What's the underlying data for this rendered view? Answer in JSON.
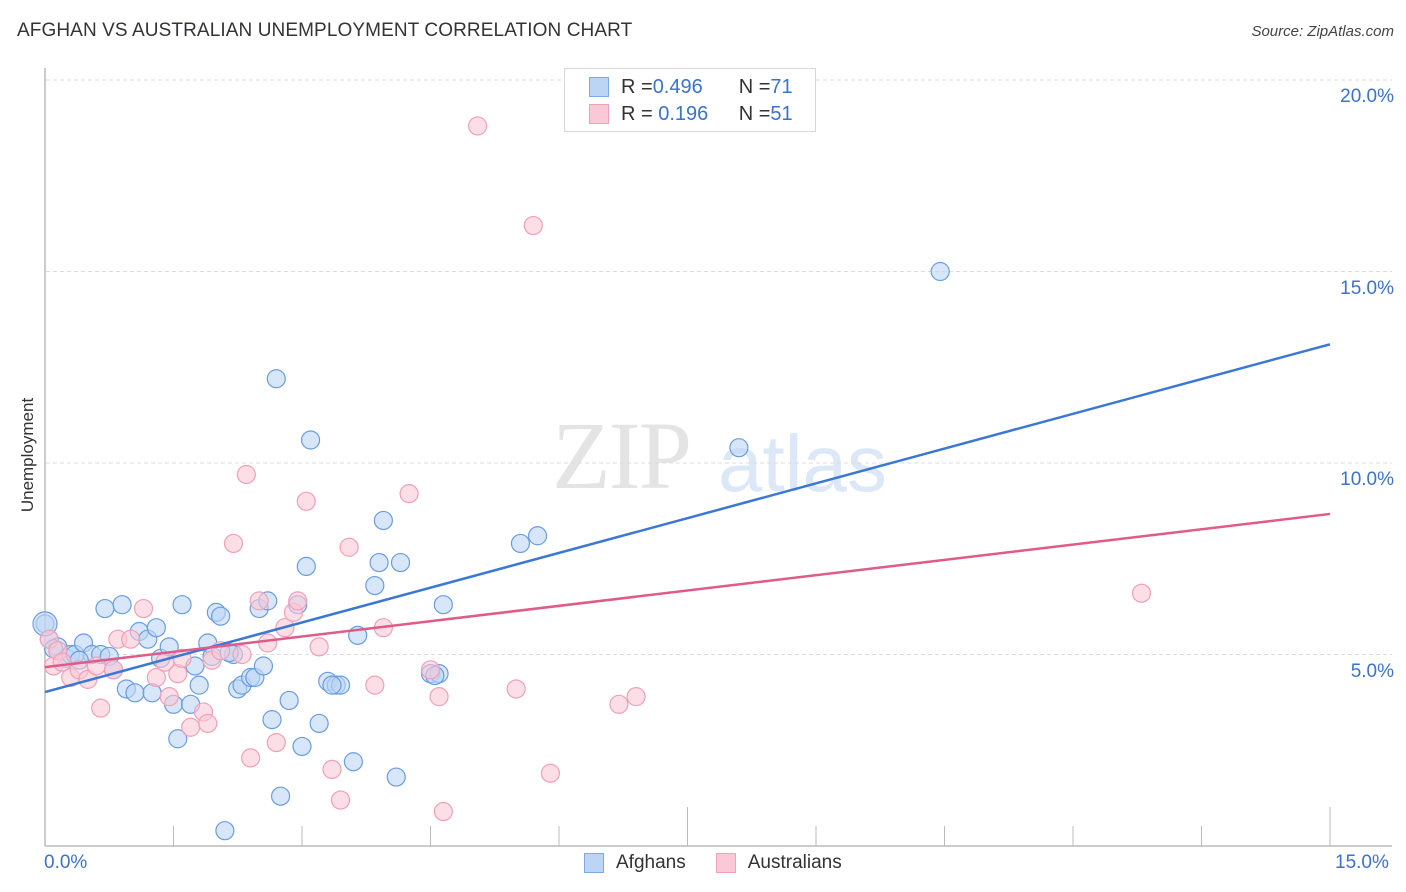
{
  "header": {
    "title": "AFGHAN VS AUSTRALIAN UNEMPLOYMENT CORRELATION CHART",
    "source": "Source: ZipAtlas.com"
  },
  "watermark": {
    "zip": "ZIP",
    "atlas": "atlas"
  },
  "legend": {
    "rows": [
      {
        "r_label": "R = ",
        "r_value": "0.496",
        "n_label": "N = ",
        "n_value": "71",
        "color": "#7aaae8",
        "fill": "#bcd5f5"
      },
      {
        "r_label": "R = ",
        "r_value": " 0.196",
        "n_label": "N = ",
        "n_value": "51",
        "color": "#f0a0b8",
        "fill": "#fac8d6"
      }
    ]
  },
  "chart_data": {
    "type": "scatter",
    "title": "AFGHAN VS AUSTRALIAN UNEMPLOYMENT CORRELATION CHART",
    "xlabel": "",
    "ylabel": "Unemployment",
    "xlim": [
      0,
      15
    ],
    "ylim": [
      0,
      20.5
    ],
    "x_tick_labels": [
      "0.0%",
      "15.0%"
    ],
    "y_ticks": [
      5,
      10,
      15,
      20
    ],
    "y_tick_labels": [
      "5.0%",
      "10.0%",
      "15.0%",
      "20.0%"
    ],
    "grid": "horizontal-dashed",
    "legend_position": "bottom-center",
    "series": [
      {
        "name": "Afghans",
        "color": "#3a78d4",
        "fill": "#bcd5f5",
        "stroke": "#6a9de0",
        "R": 0.496,
        "N": 71,
        "trend": {
          "x": [
            0,
            15
          ],
          "y": [
            4.02,
            13.1
          ]
        },
        "points": [
          [
            0.0,
            5.8
          ],
          [
            0.05,
            5.4
          ],
          [
            0.15,
            5.2
          ],
          [
            0.25,
            4.9
          ],
          [
            0.3,
            5.0
          ],
          [
            0.35,
            5.0
          ],
          [
            0.45,
            5.3
          ],
          [
            0.55,
            5.0
          ],
          [
            0.65,
            5.0
          ],
          [
            0.75,
            4.95
          ],
          [
            0.7,
            6.2
          ],
          [
            0.9,
            6.3
          ],
          [
            0.8,
            4.6
          ],
          [
            0.95,
            4.1
          ],
          [
            1.05,
            4.0
          ],
          [
            1.1,
            5.6
          ],
          [
            1.2,
            5.4
          ],
          [
            1.3,
            5.7
          ],
          [
            1.35,
            4.9
          ],
          [
            1.45,
            5.2
          ],
          [
            1.5,
            3.7
          ],
          [
            1.55,
            2.8
          ],
          [
            1.6,
            6.3
          ],
          [
            1.7,
            3.7
          ],
          [
            1.75,
            4.7
          ],
          [
            1.8,
            4.2
          ],
          [
            1.9,
            5.3
          ],
          [
            1.95,
            4.95
          ],
          [
            2.0,
            6.1
          ],
          [
            2.05,
            6.0
          ],
          [
            2.1,
            0.4
          ],
          [
            2.2,
            5.0
          ],
          [
            2.25,
            4.1
          ],
          [
            2.3,
            4.2
          ],
          [
            2.4,
            4.4
          ],
          [
            2.45,
            4.4
          ],
          [
            2.5,
            6.2
          ],
          [
            2.55,
            4.7
          ],
          [
            2.6,
            6.4
          ],
          [
            2.65,
            3.3
          ],
          [
            2.7,
            12.2
          ],
          [
            2.75,
            1.3
          ],
          [
            2.85,
            3.8
          ],
          [
            2.95,
            6.3
          ],
          [
            3.0,
            2.6
          ],
          [
            3.05,
            7.3
          ],
          [
            3.1,
            10.6
          ],
          [
            3.2,
            3.2
          ],
          [
            3.3,
            4.3
          ],
          [
            3.4,
            4.2
          ],
          [
            3.45,
            4.2
          ],
          [
            3.6,
            2.2
          ],
          [
            3.65,
            5.5
          ],
          [
            3.85,
            6.8
          ],
          [
            3.9,
            7.4
          ],
          [
            3.95,
            8.5
          ],
          [
            4.1,
            1.8
          ],
          [
            4.15,
            7.4
          ],
          [
            4.5,
            4.5
          ],
          [
            4.6,
            4.5
          ],
          [
            4.65,
            6.3
          ],
          [
            5.55,
            7.9
          ],
          [
            5.75,
            8.1
          ],
          [
            8.1,
            10.4
          ],
          [
            10.45,
            15.0
          ],
          [
            0.1,
            5.15
          ],
          [
            0.4,
            4.85
          ],
          [
            1.25,
            4.0
          ],
          [
            2.15,
            5.05
          ],
          [
            3.35,
            4.2
          ],
          [
            4.55,
            4.45
          ]
        ]
      },
      {
        "name": "Australians",
        "color": "#e05a8a",
        "fill": "#fac8d6",
        "stroke": "#f0a0b8",
        "R": 0.196,
        "N": 51,
        "trend": {
          "x": [
            0,
            15
          ],
          "y": [
            4.67,
            8.67
          ]
        },
        "points": [
          [
            0.05,
            5.4
          ],
          [
            0.1,
            4.7
          ],
          [
            0.15,
            5.1
          ],
          [
            0.2,
            4.8
          ],
          [
            0.3,
            4.4
          ],
          [
            0.4,
            4.6
          ],
          [
            0.5,
            4.35
          ],
          [
            0.6,
            4.7
          ],
          [
            0.65,
            3.6
          ],
          [
            0.8,
            4.6
          ],
          [
            0.85,
            5.4
          ],
          [
            1.0,
            5.4
          ],
          [
            1.15,
            6.2
          ],
          [
            1.3,
            4.4
          ],
          [
            1.4,
            4.8
          ],
          [
            1.45,
            3.9
          ],
          [
            1.55,
            4.5
          ],
          [
            1.6,
            4.9
          ],
          [
            1.7,
            3.1
          ],
          [
            1.85,
            3.5
          ],
          [
            1.9,
            3.2
          ],
          [
            1.95,
            4.85
          ],
          [
            2.05,
            5.1
          ],
          [
            2.2,
            7.9
          ],
          [
            2.3,
            5.0
          ],
          [
            2.35,
            9.7
          ],
          [
            2.4,
            2.3
          ],
          [
            2.5,
            6.4
          ],
          [
            2.6,
            5.3
          ],
          [
            2.7,
            2.7
          ],
          [
            2.8,
            5.7
          ],
          [
            2.9,
            6.1
          ],
          [
            2.95,
            6.4
          ],
          [
            3.05,
            9.0
          ],
          [
            3.2,
            5.2
          ],
          [
            3.35,
            2.0
          ],
          [
            3.45,
            1.2
          ],
          [
            3.55,
            7.8
          ],
          [
            3.85,
            4.2
          ],
          [
            3.95,
            5.7
          ],
          [
            4.25,
            9.2
          ],
          [
            4.5,
            4.6
          ],
          [
            4.6,
            3.9
          ],
          [
            4.65,
            0.9
          ],
          [
            5.05,
            18.8
          ],
          [
            5.5,
            4.1
          ],
          [
            5.7,
            16.2
          ],
          [
            5.9,
            1.9
          ],
          [
            6.7,
            3.7
          ],
          [
            6.9,
            3.9
          ],
          [
            12.8,
            6.6
          ]
        ]
      }
    ]
  },
  "bottom_legend": {
    "items": [
      {
        "label": "Afghans",
        "fill": "#bcd5f5",
        "stroke": "#7aaae8"
      },
      {
        "label": "Australians",
        "fill": "#fac8d6",
        "stroke": "#f0a0b8"
      }
    ]
  }
}
